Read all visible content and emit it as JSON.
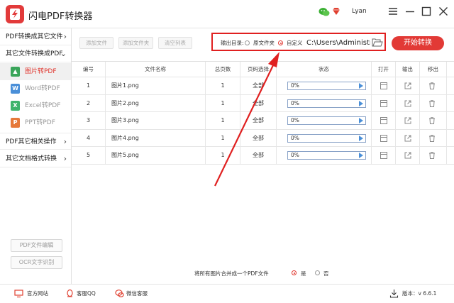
{
  "app": {
    "title": "闪电PDF转换器",
    "user": "Lyan"
  },
  "sidebar": {
    "categories": [
      {
        "label": "PDF转换成其它文件",
        "chev": "›"
      },
      {
        "label": "其它文件转换成PDF",
        "chev": "⌄"
      },
      {
        "label": "PDF其它相关操作",
        "chev": "›"
      },
      {
        "label": "其它文档格式转换",
        "chev": "›"
      }
    ],
    "subitems": [
      {
        "label": "图片转PDF",
        "icon": "image-icon",
        "badge": "▲",
        "color": "#3aa55a"
      },
      {
        "label": "Word转PDF",
        "icon": "word-icon",
        "badge": "W",
        "color": "#4a8fd8"
      },
      {
        "label": "Excel转PDF",
        "icon": "excel-icon",
        "badge": "X",
        "color": "#3fb36b"
      },
      {
        "label": "PPT转PDF",
        "icon": "ppt-icon",
        "badge": "P",
        "color": "#e6793a"
      }
    ],
    "bottom_buttons": [
      "PDF文件编辑",
      "OCR文字识别"
    ]
  },
  "toolbar": {
    "add_file": "添加文件",
    "add_folder": "添加文件夹",
    "clear_list": "清空列表"
  },
  "output": {
    "label": "输出目录:",
    "option_source": "原文件夹",
    "option_custom": "自定义",
    "selected": "自定义",
    "path": "C:\\Users\\Administrator\\Desktop"
  },
  "start_label": "开始转换",
  "table": {
    "headers": [
      "编号",
      "文件名称",
      "总页数",
      "页码选择",
      "状态",
      "打开",
      "输出",
      "移出"
    ],
    "rows": [
      {
        "no": "1",
        "name": "图片1.png",
        "pages": "1",
        "range": "全部",
        "progress": "0%"
      },
      {
        "no": "2",
        "name": "图片2.png",
        "pages": "1",
        "range": "全部",
        "progress": "0%"
      },
      {
        "no": "3",
        "name": "图片3.png",
        "pages": "1",
        "range": "全部",
        "progress": "0%"
      },
      {
        "no": "4",
        "name": "图片4.png",
        "pages": "1",
        "range": "全部",
        "progress": "0%"
      },
      {
        "no": "5",
        "name": "图片5.png",
        "pages": "1",
        "range": "全部",
        "progress": "0%"
      }
    ]
  },
  "merge": {
    "label": "将所有图片合并成一个PDF文件",
    "yes": "是",
    "no": "否",
    "selected": "是"
  },
  "footer": {
    "website": "官方网站",
    "qq": "客服QQ",
    "wechat": "微信客服",
    "version": "版本：v 6.6.1"
  },
  "colors": {
    "accent": "#e23a36",
    "highlight_box": "#e02020",
    "progress_border": "#8aa3c8"
  }
}
